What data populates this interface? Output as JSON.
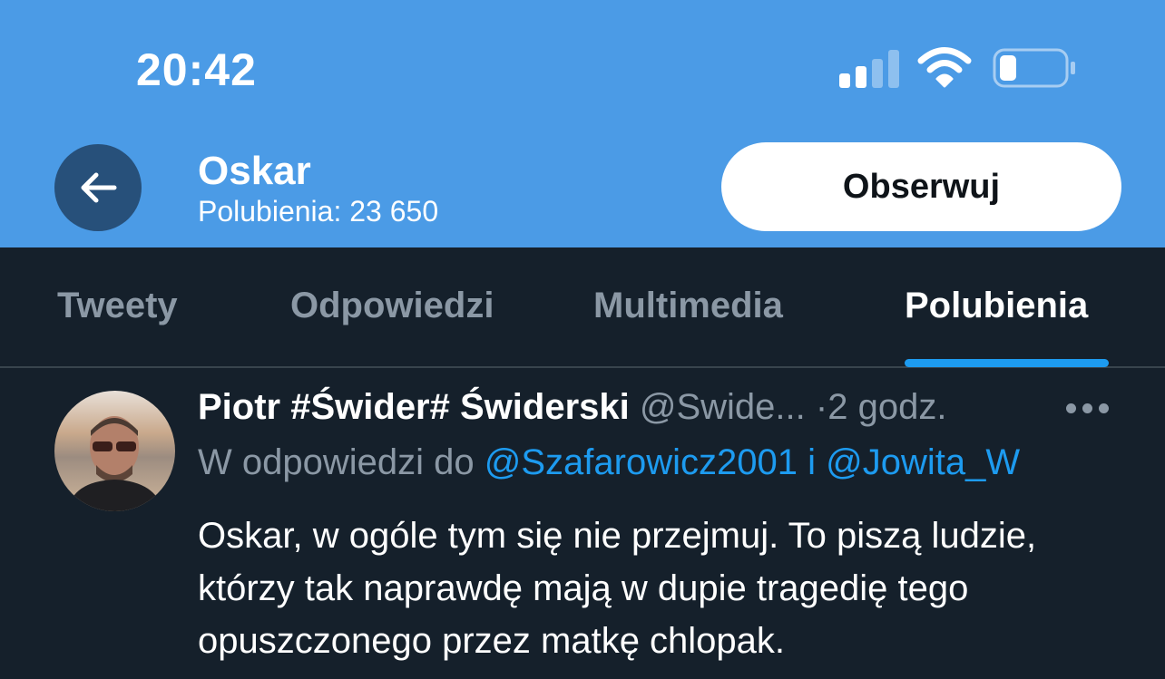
{
  "status_bar": {
    "time": "20:42",
    "icons": [
      "cellular-signal-icon",
      "wifi-icon",
      "battery-icon"
    ]
  },
  "header": {
    "name": "Oskar",
    "subtitle": "Polubienia: 23 650",
    "follow_label": "Obserwuj",
    "icons": [
      "back-arrow-icon"
    ]
  },
  "tabs": [
    {
      "label": "Tweety",
      "active": false
    },
    {
      "label": "Odpowiedzi",
      "active": false
    },
    {
      "label": "Multimedia",
      "active": false
    },
    {
      "label": "Polubienia",
      "active": true
    }
  ],
  "tweet": {
    "author_name": "Piotr #Świder# Świderski",
    "author_handle": "@Swide...",
    "separator": "·",
    "time_ago": "2 godz.",
    "reply_prefix": "W odpowiedzi do",
    "mention_1": "@Szafarowicz2001",
    "reply_and": "i",
    "mention_2": "@Jowita_W",
    "text": "Oskar, w ogóle tym się nie przejmuj. To piszą ludzie, którzy tak naprawdę mają w dupie tragedię tego opuszczonego przez matkę chlopak."
  },
  "colors": {
    "header_bg": "#4b9be6",
    "page_bg": "#15202b",
    "accent": "#1d9bf0",
    "muted_text": "#8b98a5"
  }
}
